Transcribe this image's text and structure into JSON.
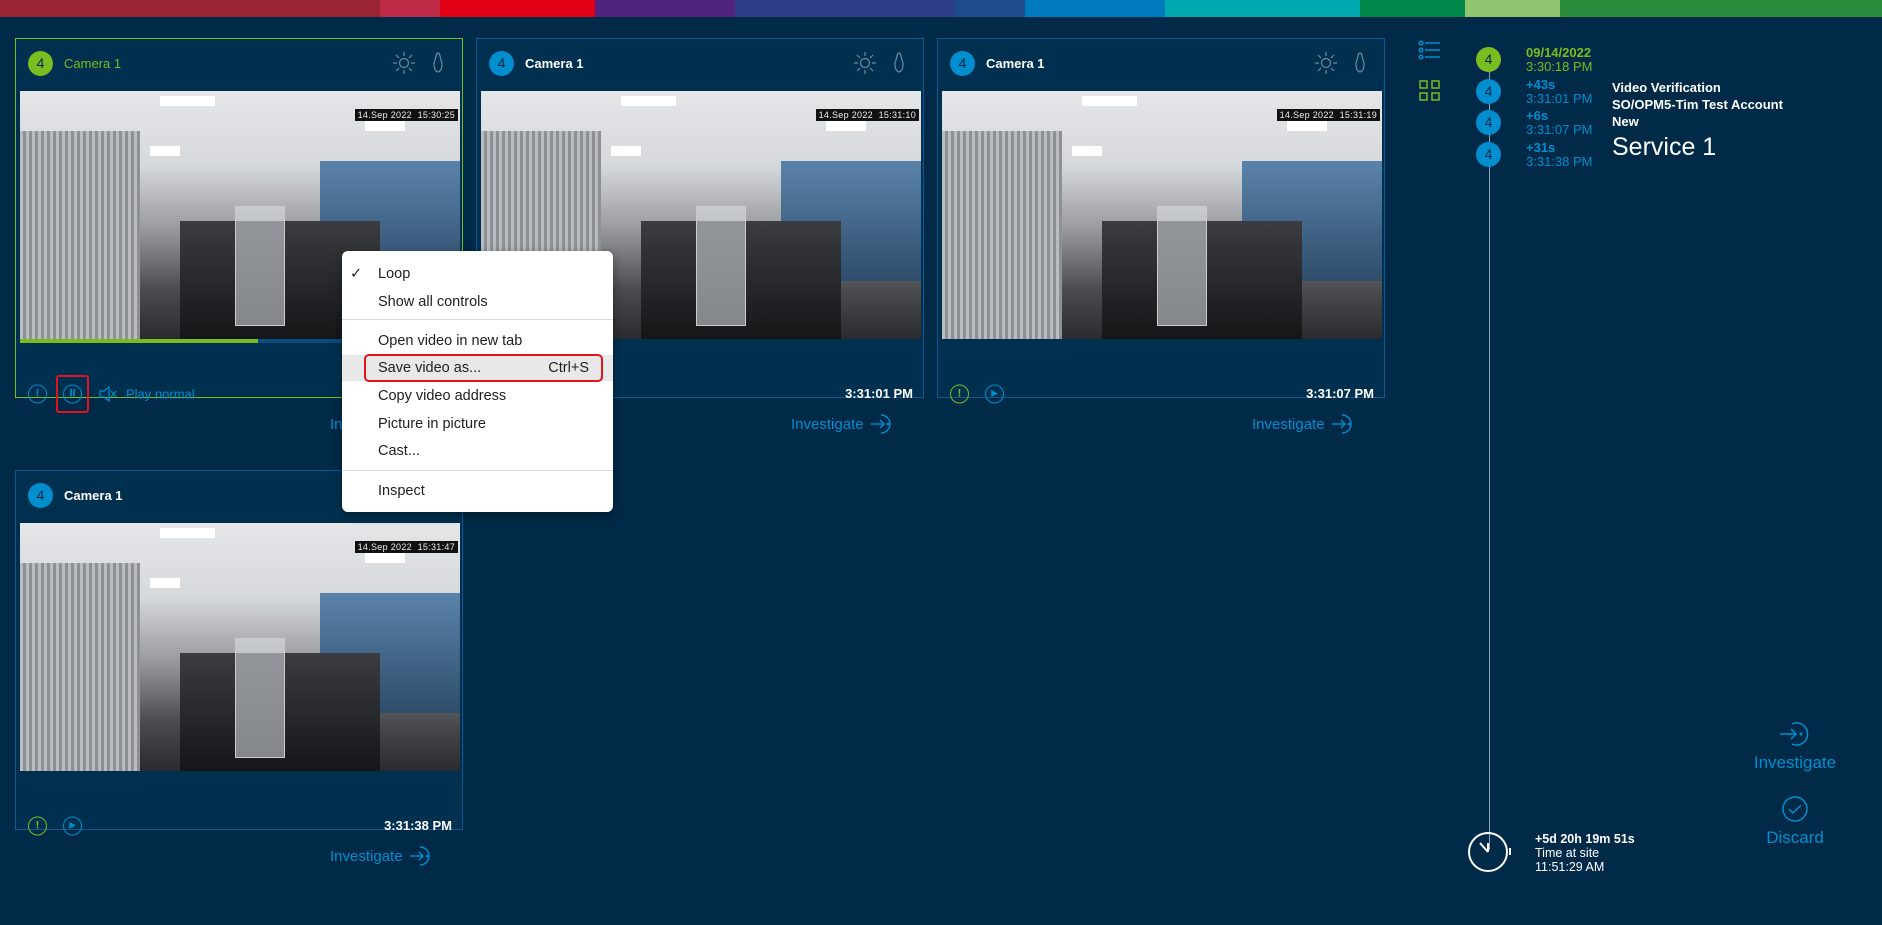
{
  "brand_bar_colors": [
    "#9b2535",
    "#be2a45",
    "#e20015",
    "#50237f",
    "#2e3d8a",
    "#1c4b8e",
    "#007bc0",
    "#00a8b0",
    "#00884a",
    "#92c36e",
    "#2b8c3e"
  ],
  "colors": {
    "background": "#002a48",
    "accent_blue": "#008ecf",
    "accent_green": "#78be20"
  },
  "cameras": [
    {
      "badge": "4",
      "title": "Camera 1",
      "overlay_date": "14.Sep 2022",
      "overlay_time": "15:30:25",
      "play_mode": "Play normal",
      "progress": 0.54,
      "investigate": "Investigate"
    },
    {
      "badge": "4",
      "title": "Camera 1",
      "overlay_date": "14.Sep 2022",
      "overlay_time": "15:31:10",
      "time": "3:31:01 PM",
      "investigate": "Investigate"
    },
    {
      "badge": "4",
      "title": "Camera 1",
      "overlay_date": "14.Sep 2022",
      "overlay_time": "15:31:19",
      "time": "3:31:07 PM",
      "investigate": "Investigate"
    },
    {
      "badge": "4",
      "title": "Camera 1",
      "overlay_date": "14.Sep 2022",
      "overlay_time": "15:31:47",
      "time": "3:31:38 PM",
      "investigate": "Investigate"
    }
  ],
  "context_menu": {
    "loop": "Loop",
    "loop_checked": "✓",
    "show_all_controls": "Show all controls",
    "open_new_tab": "Open video in new tab",
    "save_video": "Save video as...",
    "save_shortcut": "Ctrl+S",
    "copy_address": "Copy video address",
    "pip": "Picture in picture",
    "cast": "Cast...",
    "inspect": "Inspect"
  },
  "timeline": [
    {
      "badge": "4",
      "delta": "09/14/2022",
      "time": "3:30:18 PM"
    },
    {
      "badge": "4",
      "delta": "+43s",
      "time": "3:31:01 PM"
    },
    {
      "badge": "4",
      "delta": "+6s",
      "time": "3:31:07 PM"
    },
    {
      "badge": "4",
      "delta": "+31s",
      "time": "3:31:38 PM"
    }
  ],
  "alarm": {
    "type": "Video Verification",
    "account": "SO/OPM5-Tim Test Account",
    "state": "New",
    "service": "Service 1"
  },
  "site": {
    "duration": "+5d 20h 19m 51s",
    "label": "Time at site",
    "time": "11:51:29 AM"
  },
  "actions": {
    "investigate": "Investigate",
    "discard": "Discard"
  }
}
